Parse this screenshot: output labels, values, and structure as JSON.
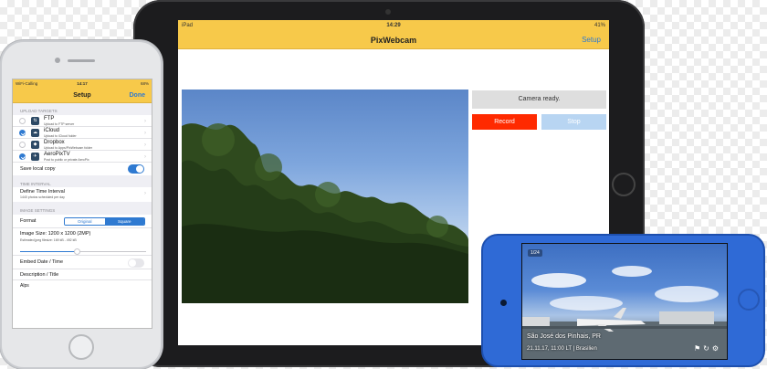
{
  "ipad": {
    "status": {
      "device": "iPad",
      "time": "14:29",
      "battery": "41%"
    },
    "nav": {
      "title": "PixWebcam",
      "setup_label": "Setup"
    },
    "camera_status": "Camera ready.",
    "record_label": "Record",
    "stop_label": "Stop"
  },
  "iphone": {
    "status": {
      "carrier": "WiFi-Calling",
      "time": "14:17",
      "battery": "68%"
    },
    "nav": {
      "title": "Setup",
      "done_label": "Done"
    },
    "upload_header": "UPLOAD TARGETS",
    "targets": [
      {
        "title": "FTP",
        "subtitle": "Upload to FTP server",
        "icon": "ftp-icon",
        "checked": false
      },
      {
        "title": "iCloud",
        "subtitle": "Upload to iCloud folder",
        "icon": "cloud-icon",
        "checked": true
      },
      {
        "title": "Dropbox",
        "subtitle": "Upload to Apps/PixWebcam folder",
        "icon": "dropbox-icon",
        "checked": false
      },
      {
        "title": "AeroPixTV",
        "subtitle": "Post to public or private AeroPix",
        "icon": "plane-icon",
        "checked": true
      }
    ],
    "save_local_label": "Save local copy",
    "save_local_on": true,
    "time_header": "TIME INTERVAL",
    "interval_title": "Define Time Interval",
    "interval_sub": "1440 photos scheduled per day",
    "image_header": "IMAGE SETTINGS",
    "format_label": "Format",
    "format_options": [
      "Original",
      "Square"
    ],
    "format_selected": "Square",
    "image_size_label": "Image Size: 1200 x 1200 (2MP)",
    "image_size_sub": "Estimated jpeg filesize: 169 kB - 492 kB",
    "image_size_level": 0.45,
    "embed_label": "Embed Date / Time",
    "embed_on": false,
    "description_label": "Description / Title",
    "description_value": "Alps"
  },
  "ipod": {
    "badge": "1/24",
    "place": "São José dos Pinhais, PR",
    "timestamp": "21.11.17, 11:00 LT | Brasilien"
  },
  "colors": {
    "navbar_yellow": "#f7c94a",
    "accent_blue": "#2f7ad1",
    "record_red": "#ff2a00",
    "stop_light_blue": "#b8d5f2",
    "ipod_blue": "#2f6ad6"
  }
}
